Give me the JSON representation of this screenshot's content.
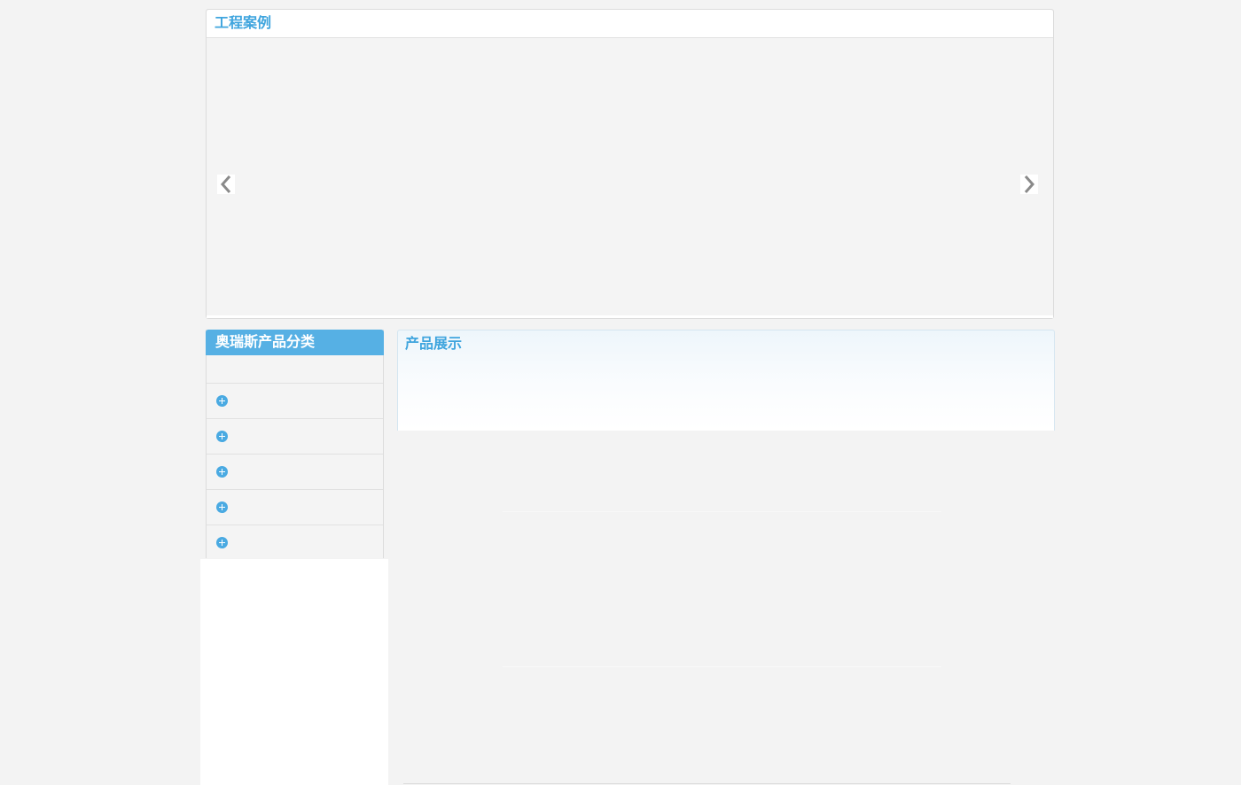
{
  "cases": {
    "title": "工程案例",
    "prev_icon": "chevron-left-icon",
    "next_icon": "chevron-right-icon"
  },
  "category": {
    "title": "奥瑞斯产品分类",
    "items": [
      {
        "label": "",
        "icon": "plus-circle-icon"
      },
      {
        "label": "",
        "icon": "plus-circle-icon"
      },
      {
        "label": "",
        "icon": "plus-circle-icon"
      },
      {
        "label": "",
        "icon": "plus-circle-icon"
      },
      {
        "label": "",
        "icon": "plus-circle-icon"
      }
    ]
  },
  "products": {
    "title": "产品展示"
  },
  "colors": {
    "accent": "#3fa5de",
    "category_header": "#56b0e4",
    "icon": "#4aaae2",
    "background": "#f3f3f3"
  }
}
